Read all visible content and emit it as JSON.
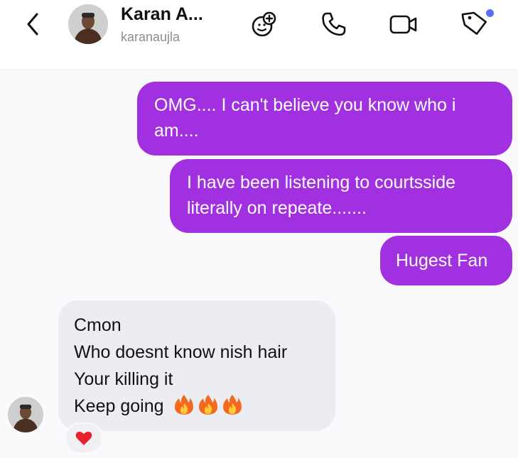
{
  "header": {
    "contact_name": "Karan A...",
    "contact_username": "karanaujla",
    "icons": [
      "back-arrow-icon",
      "effects-icon",
      "phone-icon",
      "video-icon",
      "tag-icon"
    ],
    "notification_dot_color": "#5b6cf5"
  },
  "messages": {
    "outgoing": [
      {
        "lines": [
          "OMG.... I can't believe you know who i",
          "am...."
        ]
      },
      {
        "lines": [
          "I have been listening to courtsside",
          "literally on repeate......."
        ]
      },
      {
        "lines": [
          "Hugest Fan"
        ]
      }
    ],
    "incoming": {
      "lines": [
        "Cmon",
        "Who doesnt know nish hair",
        "Your killing it",
        "Keep going"
      ],
      "emoji": "fire-emoji x3"
    }
  },
  "reaction": {
    "emoji": "heart-emoji"
  },
  "colors": {
    "outgoing_bubble": "#a130e1",
    "incoming_bubble": "#ecedf3",
    "chat_background": "#fafafc"
  }
}
